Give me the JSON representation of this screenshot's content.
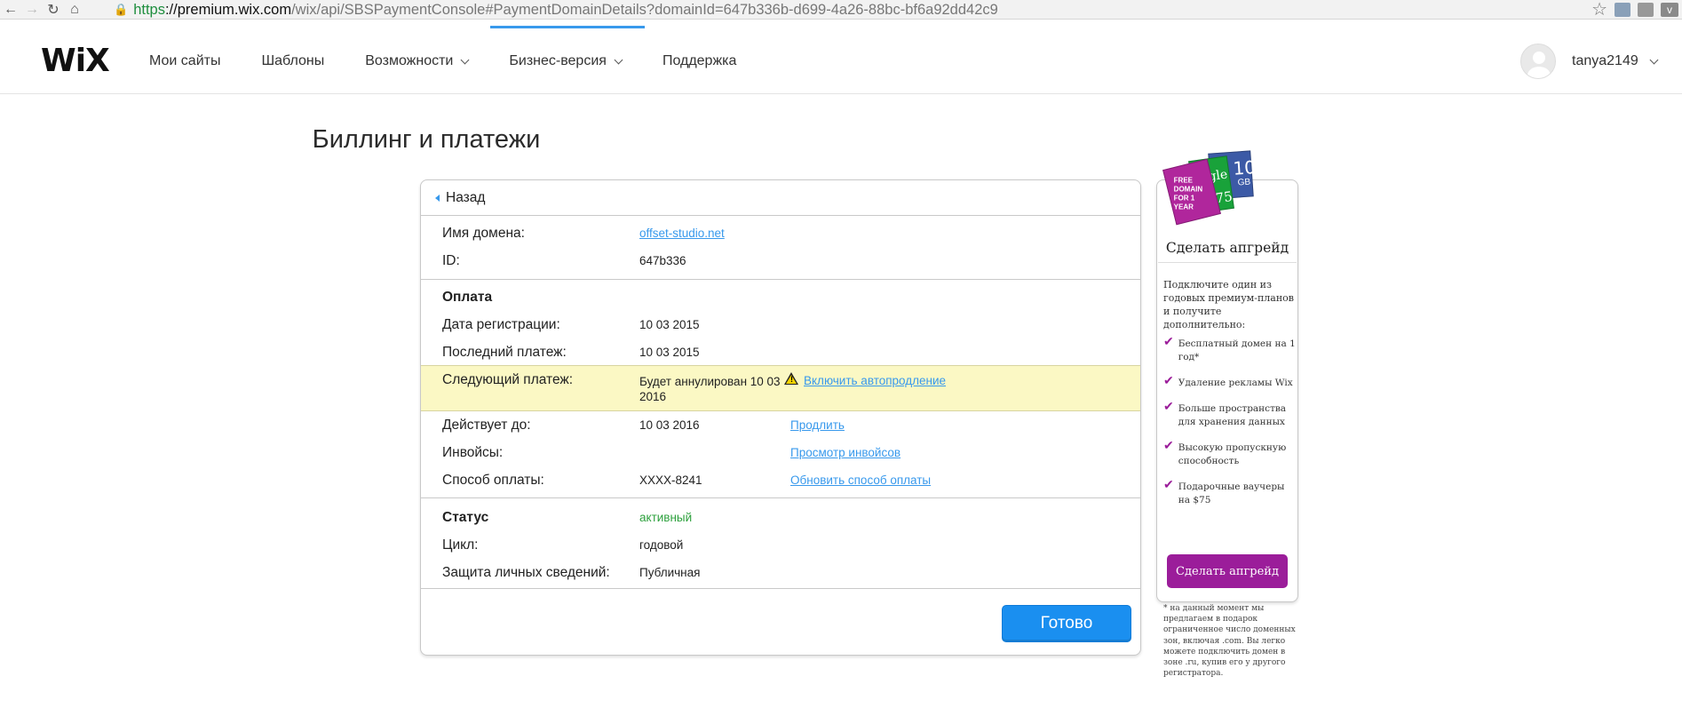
{
  "browser": {
    "url_scheme": "https",
    "url_host": "://premium.wix.com",
    "url_path": "/wix/api/SBSPaymentConsole#PaymentDomainDetails?domainId=647b336b-d699-4a26-88bc-bf6a92dd42c9",
    "ext_v": "v"
  },
  "header": {
    "logo": "WiX",
    "menu": [
      {
        "label": "Мои сайты"
      },
      {
        "label": "Шаблоны"
      },
      {
        "label": "Возможности"
      },
      {
        "label": "Бизнес-версия"
      },
      {
        "label": "Поддержка"
      }
    ],
    "username": "tanya2149"
  },
  "page": {
    "title": "Биллинг и платежи",
    "back_label": "Назад",
    "domain_label": "Имя домена:",
    "domain_value": "offset-studio.net",
    "id_label": "ID:",
    "id_value": "647b336",
    "payment_heading": "Оплата",
    "reg_date_label": "Дата регистрации:",
    "reg_date_value": "10 03 2015",
    "last_payment_label": "Последний платеж:",
    "last_payment_value": "10 03 2015",
    "next_payment_label": "Следующий платеж:",
    "next_payment_value_line1": "Будет аннулирован 10 03",
    "next_payment_value_line2": "2016",
    "autorenew_link": "Включить автопродление",
    "valid_until_label": "Действует до:",
    "valid_until_value": "10 03 2016",
    "extend_link": "Продлить",
    "invoices_label": "Инвойсы:",
    "invoices_link": "Просмотр инвойсов",
    "payment_method_label": "Способ оплаты:",
    "payment_method_value": "XXXX-8241",
    "update_payment_link": "Обновить способ оплаты",
    "status_heading": "Статус",
    "status_value": "активный",
    "cycle_label": "Цикл:",
    "cycle_value": "годовой",
    "privacy_label": "Защита личных сведений:",
    "privacy_value": "Публичная",
    "done_button": "Готово"
  },
  "upgrade": {
    "badge_domain": "FREE DOMAIN FOR 1 YEAR",
    "badge_google": "oogle",
    "badge_google_amount": "$75",
    "badge_storage_num": "10",
    "badge_storage_unit": "GB",
    "title": "Сделать апгрейд",
    "intro": "Подключите один из годовых премиум-планов и получите дополнительно:",
    "benefits": [
      "Бесплатный домен на 1 год*",
      "Удаление рекламы Wix",
      "Больше пространства для хранения данных",
      "Высокую пропускную способность",
      "Подарочные ваучеры на $75"
    ],
    "button": "Сделать апгрейд",
    "footnote": "* на данный момент мы предлагаем в подарок ограниченное число доменных зон, включая .com. Вы легко можете подключить домен в зоне .ru, купив его у другого регистратора."
  },
  "colors": {
    "accent_blue": "#3899ec",
    "done_button": "#1a8ff0",
    "upgrade_purple": "#9b1d9a",
    "highlight_yellow": "#fbf8c4",
    "status_green": "#2ea13e"
  }
}
